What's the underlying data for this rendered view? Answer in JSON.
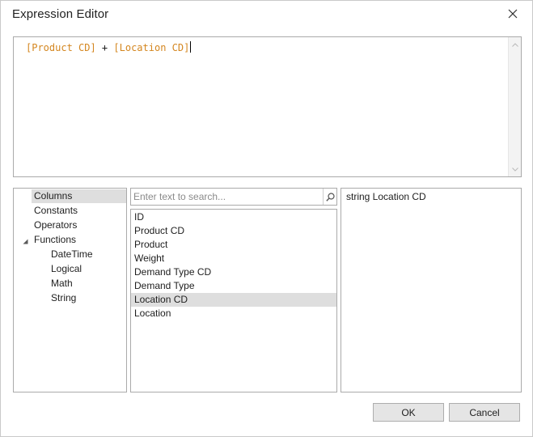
{
  "window": {
    "title": "Expression Editor"
  },
  "editor": {
    "tokens": [
      "[Product CD]",
      " + ",
      "[Location CD]"
    ]
  },
  "tree": {
    "items": [
      "Columns",
      "Constants",
      "Operators",
      "Functions",
      "DateTime",
      "Logical",
      "Math",
      "String"
    ],
    "selected": "Columns"
  },
  "search": {
    "placeholder": "Enter text to search..."
  },
  "columns": {
    "items": [
      "ID",
      "Product CD",
      "Product",
      "Weight",
      "Demand Type CD",
      "Demand Type",
      "Location CD",
      "Location"
    ],
    "selected": "Location CD"
  },
  "description": {
    "text": "string Location CD"
  },
  "buttons": {
    "ok": "OK",
    "cancel": "Cancel"
  },
  "colors": {
    "column_token": "#d4861f",
    "selection": "#dedede",
    "border": "#aaaaaa"
  },
  "icons": {
    "close": "close-icon",
    "search": "search-icon",
    "expander": "expanded-triangle-icon",
    "scroll_up": "scroll-up-icon",
    "scroll_down": "scroll-down-icon"
  }
}
